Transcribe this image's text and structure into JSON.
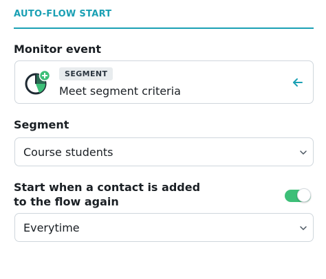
{
  "header": {
    "title": "AUTO-FLOW START"
  },
  "monitor_event": {
    "label": "Monitor event",
    "tag": "SEGMENT",
    "description": "Meet segment criteria",
    "icon": "segment-pie-plus-icon",
    "action_icon": "arrow-left-icon"
  },
  "segment": {
    "label": "Segment",
    "value": "Course students"
  },
  "restart": {
    "label_line1": "Start when a contact is added",
    "label_line2": "to the flow again",
    "toggle_on": true,
    "value": "Everytime"
  },
  "colors": {
    "accent": "#1aa0b4",
    "toggle": "#3dbf78",
    "icon_dark": "#1f2a33"
  }
}
